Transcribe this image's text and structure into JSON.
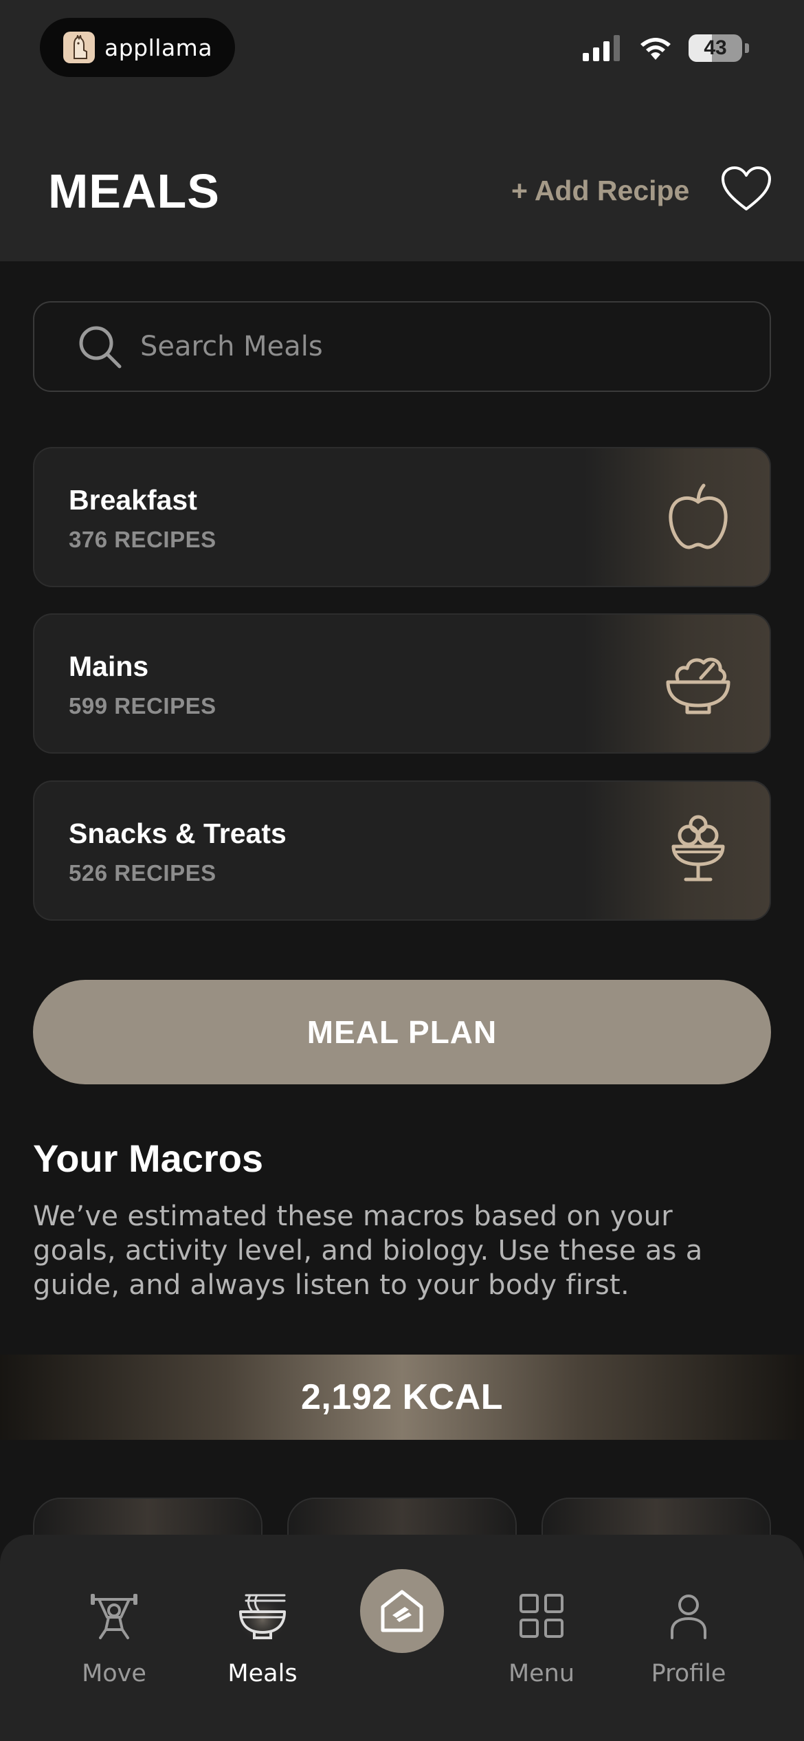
{
  "status_bar": {
    "app_badge": "appllama",
    "battery": "43",
    "battery_level": 0.43
  },
  "header": {
    "title": "MEALS",
    "add_recipe_label": "+ Add Recipe",
    "favorite_icon": "heart-icon"
  },
  "search": {
    "placeholder": "Search Meals",
    "value": ""
  },
  "categories": [
    {
      "title": "Breakfast",
      "count": "376 RECIPES",
      "icon": "apple-icon"
    },
    {
      "title": "Mains",
      "count": "599 RECIPES",
      "icon": "salad-bowl-icon"
    },
    {
      "title": "Snacks & Treats",
      "count": "526 RECIPES",
      "icon": "ice-cream-icon"
    }
  ],
  "meal_plan_label": "MEAL PLAN",
  "macros": {
    "title": "Your Macros",
    "description": "We’ve estimated these macros based on your goals, activity level, and biology. Use these as a guide, and always listen to your body first.",
    "kcal": "2,192 KCAL"
  },
  "tabbar": {
    "items": [
      {
        "label": "Move",
        "icon": "weightlifter-icon",
        "active": false
      },
      {
        "label": "Meals",
        "icon": "noodle-bowl-icon",
        "active": true
      },
      {
        "label": "",
        "icon": "home-logo-icon",
        "active": false
      },
      {
        "label": "Menu",
        "icon": "grid-icon",
        "active": false
      },
      {
        "label": "Profile",
        "icon": "person-icon",
        "active": false
      }
    ]
  },
  "colors": {
    "accent": "#999083",
    "accent_text": "#a59a88",
    "background": "#151515",
    "header_bg": "#262626",
    "card_bg": "#212121",
    "icon_tan": "#cdb9a0"
  }
}
